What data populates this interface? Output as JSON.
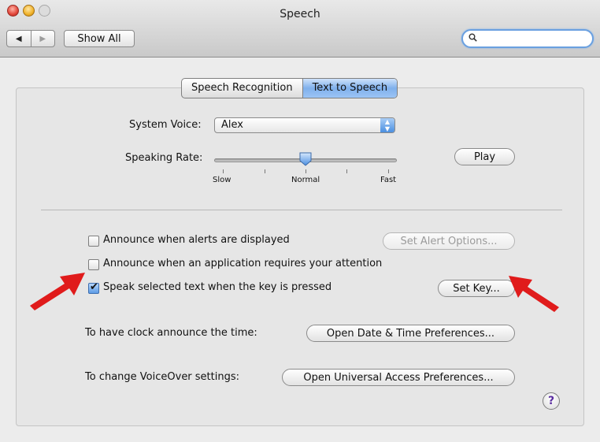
{
  "window": {
    "title": "Speech"
  },
  "toolbar": {
    "back_glyph": "◀",
    "forward_glyph": "▶",
    "show_all": "Show All",
    "search_icon": "🔍",
    "search_value": ""
  },
  "tabs": [
    {
      "label": "Speech Recognition",
      "active": false
    },
    {
      "label": "Text to Speech",
      "active": true
    }
  ],
  "voice": {
    "label": "System Voice:",
    "value": "Alex"
  },
  "rate": {
    "label": "Speaking Rate:",
    "min_label": "Slow",
    "mid_label": "Normal",
    "max_label": "Fast",
    "value_fraction": 0.5
  },
  "play_button": "Play",
  "options": [
    {
      "label": "Announce when alerts are displayed",
      "checked": false,
      "button": "Set Alert Options...",
      "button_enabled": false
    },
    {
      "label": "Announce when an application requires your attention",
      "checked": false
    },
    {
      "label": "Speak selected text when the key is pressed",
      "checked": true,
      "button": "Set Key...",
      "button_enabled": true
    }
  ],
  "clock": {
    "label": "To have clock announce the time:",
    "button": "Open Date & Time Preferences..."
  },
  "voiceover": {
    "label": "To change VoiceOver settings:",
    "button": "Open Universal Access Preferences..."
  },
  "help": "?",
  "annotation_color": "#e01b1b",
  "accent_color": "#6aa0e0"
}
